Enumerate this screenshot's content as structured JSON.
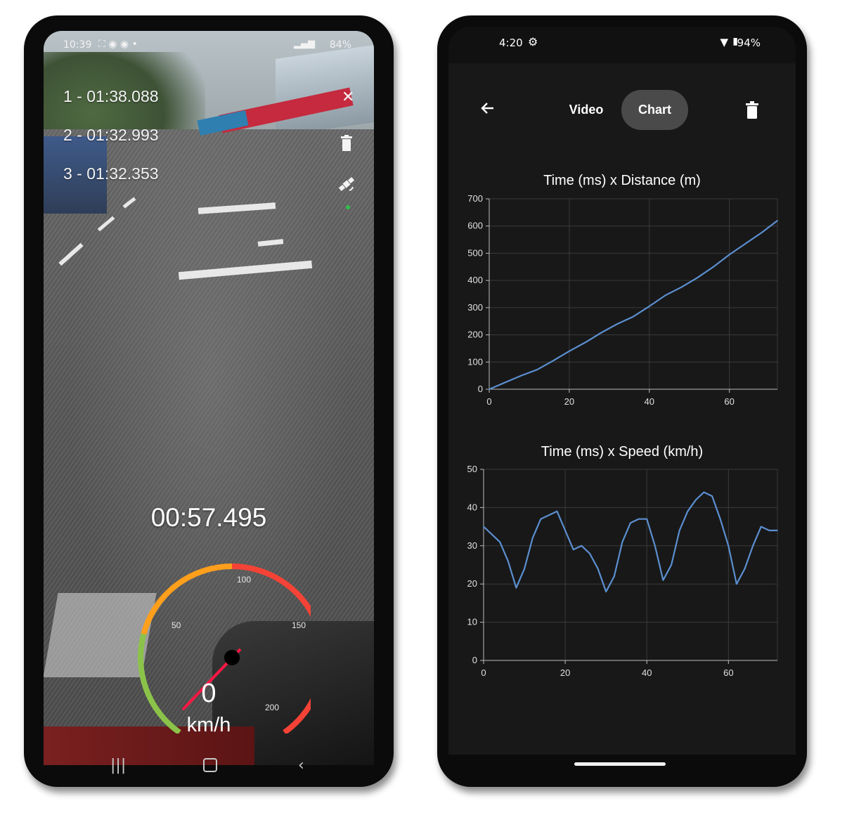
{
  "left_phone": {
    "status_time": "10:39",
    "status_battery": "84%",
    "laps": [
      "1 - 01:38.088",
      "2 - 01:32.993",
      "3 - 01:32.353"
    ],
    "timer": "00:57.495",
    "gauge": {
      "tick_labels": [
        "50",
        "100",
        "150",
        "200"
      ],
      "speed": "0",
      "unit": "km/h",
      "colors": {
        "low": "#8bc34a",
        "mid": "#ff9f1c",
        "high": "#f44336",
        "needle": "#ff1744"
      }
    },
    "icons": [
      "close-icon",
      "trash-icon",
      "satellite-icon"
    ],
    "navbar_icons": [
      "recent-apps-icon",
      "home-icon",
      "back-icon"
    ]
  },
  "right_phone": {
    "status_time": "4:20",
    "status_battery": "94%",
    "toolbar": {
      "video_label": "Video",
      "chart_label": "Chart",
      "active_tab": "Chart"
    },
    "line_color": "#5b8fd0",
    "chart_data": [
      {
        "type": "line",
        "title": "Time (ms) x Distance (m)",
        "xlim": [
          0,
          72
        ],
        "ylim": [
          0,
          700
        ],
        "xticks": [
          0,
          20,
          40,
          60
        ],
        "yticks": [
          0,
          100,
          200,
          300,
          400,
          500,
          600,
          700
        ],
        "grid": true,
        "x": [
          0,
          4,
          8,
          12,
          16,
          20,
          24,
          28,
          32,
          36,
          40,
          44,
          48,
          52,
          56,
          60,
          64,
          68,
          72
        ],
        "y": [
          0,
          25,
          50,
          72,
          105,
          140,
          172,
          208,
          240,
          267,
          305,
          345,
          375,
          410,
          450,
          495,
          535,
          575,
          620
        ]
      },
      {
        "type": "line",
        "title": "Time (ms) x Speed (km/h)",
        "xlim": [
          0,
          72
        ],
        "ylim": [
          0,
          50
        ],
        "xticks": [
          0,
          20,
          40,
          60
        ],
        "yticks": [
          0,
          10,
          20,
          30,
          40,
          50
        ],
        "grid": true,
        "x": [
          0,
          2,
          4,
          6,
          8,
          10,
          12,
          14,
          16,
          18,
          20,
          22,
          24,
          26,
          28,
          30,
          32,
          34,
          36,
          38,
          40,
          42,
          44,
          46,
          48,
          50,
          52,
          54,
          56,
          58,
          60,
          62,
          64,
          66,
          68,
          70,
          72
        ],
        "y": [
          35,
          33,
          31,
          26,
          19,
          24,
          32,
          37,
          38,
          39,
          34,
          29,
          30,
          28,
          24,
          18,
          22,
          31,
          36,
          37,
          37,
          30,
          21,
          25,
          34,
          39,
          42,
          44,
          43,
          37,
          30,
          20,
          24,
          30,
          35,
          34,
          34
        ]
      }
    ]
  }
}
